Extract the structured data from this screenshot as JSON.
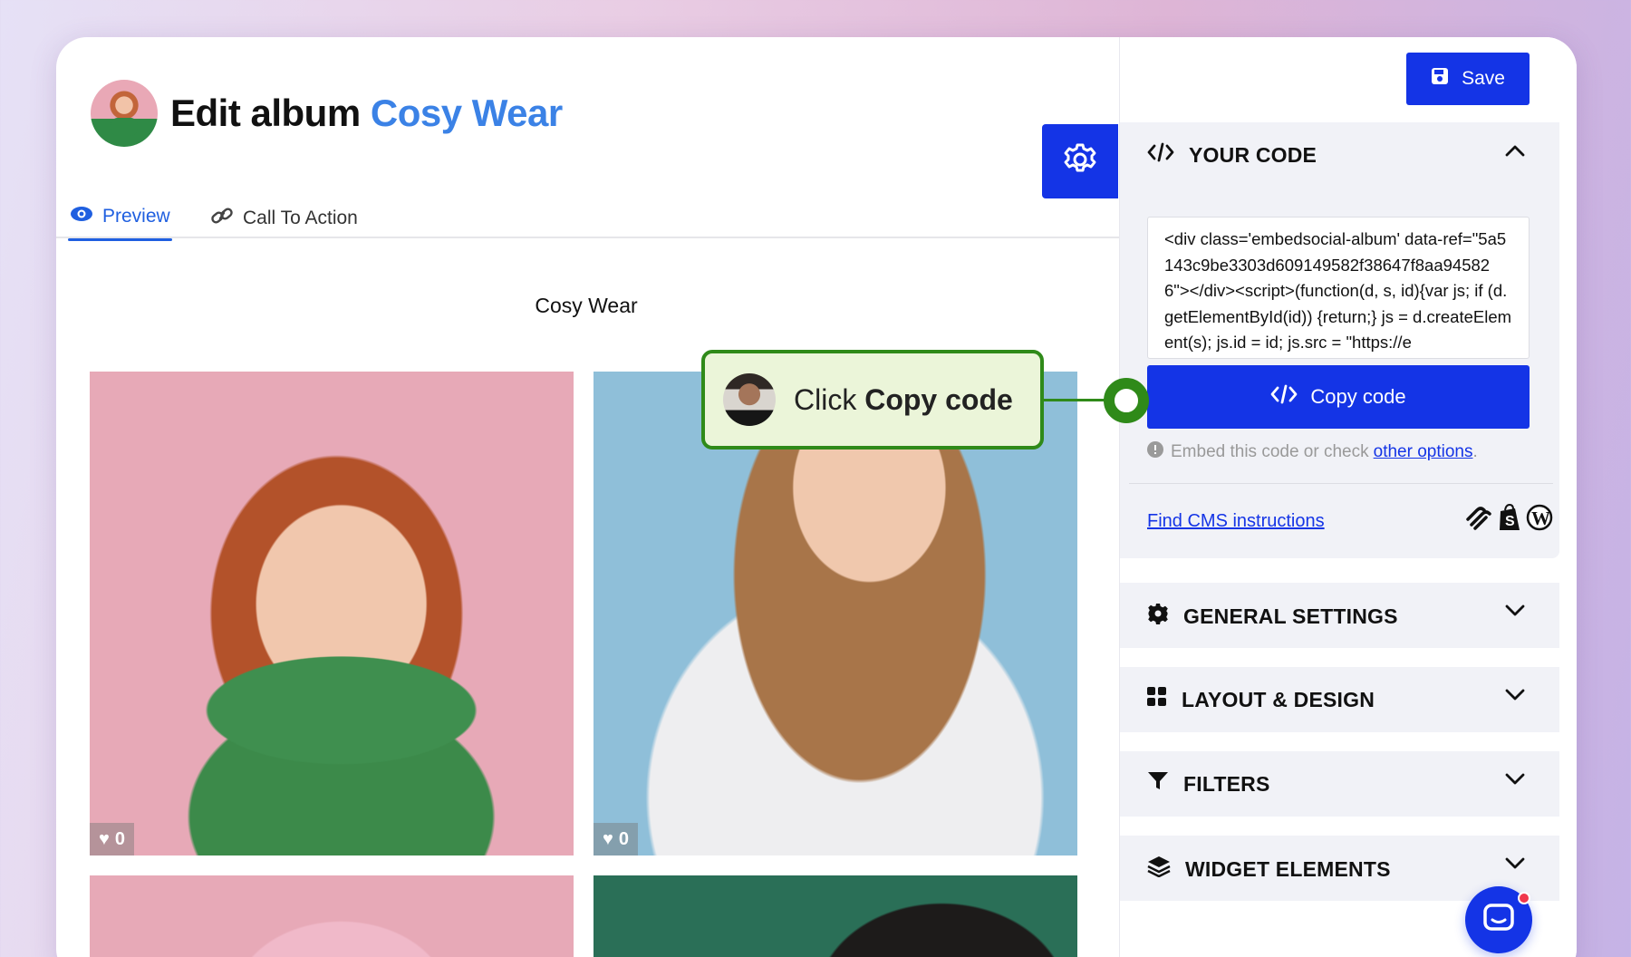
{
  "header": {
    "title_prefix": "Edit album",
    "album_name": "Cosy Wear"
  },
  "tabs": [
    {
      "label": "Preview",
      "active": true,
      "icon": "eye-icon"
    },
    {
      "label": "Call To Action",
      "active": false,
      "icon": "link-icon"
    }
  ],
  "preview": {
    "heading": "Cosy Wear",
    "photos": [
      {
        "likes": "0"
      },
      {
        "likes": "0"
      },
      {
        "likes": ""
      },
      {
        "likes": ""
      }
    ]
  },
  "callout": {
    "prefix": "Click",
    "action": "Copy code"
  },
  "panel": {
    "save_label": "Save",
    "code_section": {
      "title": "YOUR CODE",
      "code": "<div class='embedsocial-album' data-ref=\"5a5143c9be3303d609149582f38647f8aa945826\"></div><script>(function(d, s, id){var js; if (d.getElementById(id)) {return;} js = d.createElement(s); js.id = id; js.src = \"https://e",
      "copy_label": "Copy code",
      "hint_text": "Embed this code or check",
      "hint_link": "other options",
      "hint_end": ".",
      "cms_link": "Find CMS instructions"
    },
    "sections": [
      {
        "title": "GENERAL SETTINGS",
        "icon": "gear-icon"
      },
      {
        "title": "LAYOUT & DESIGN",
        "icon": "grid-icon"
      },
      {
        "title": "FILTERS",
        "icon": "filter-icon"
      },
      {
        "title": "WIDGET ELEMENTS",
        "icon": "layers-icon"
      }
    ]
  },
  "colors": {
    "primary": "#1434e6",
    "accent_title": "#3b82e6",
    "callout_border": "#2f8a19",
    "callout_bg": "#ebf5d9"
  }
}
